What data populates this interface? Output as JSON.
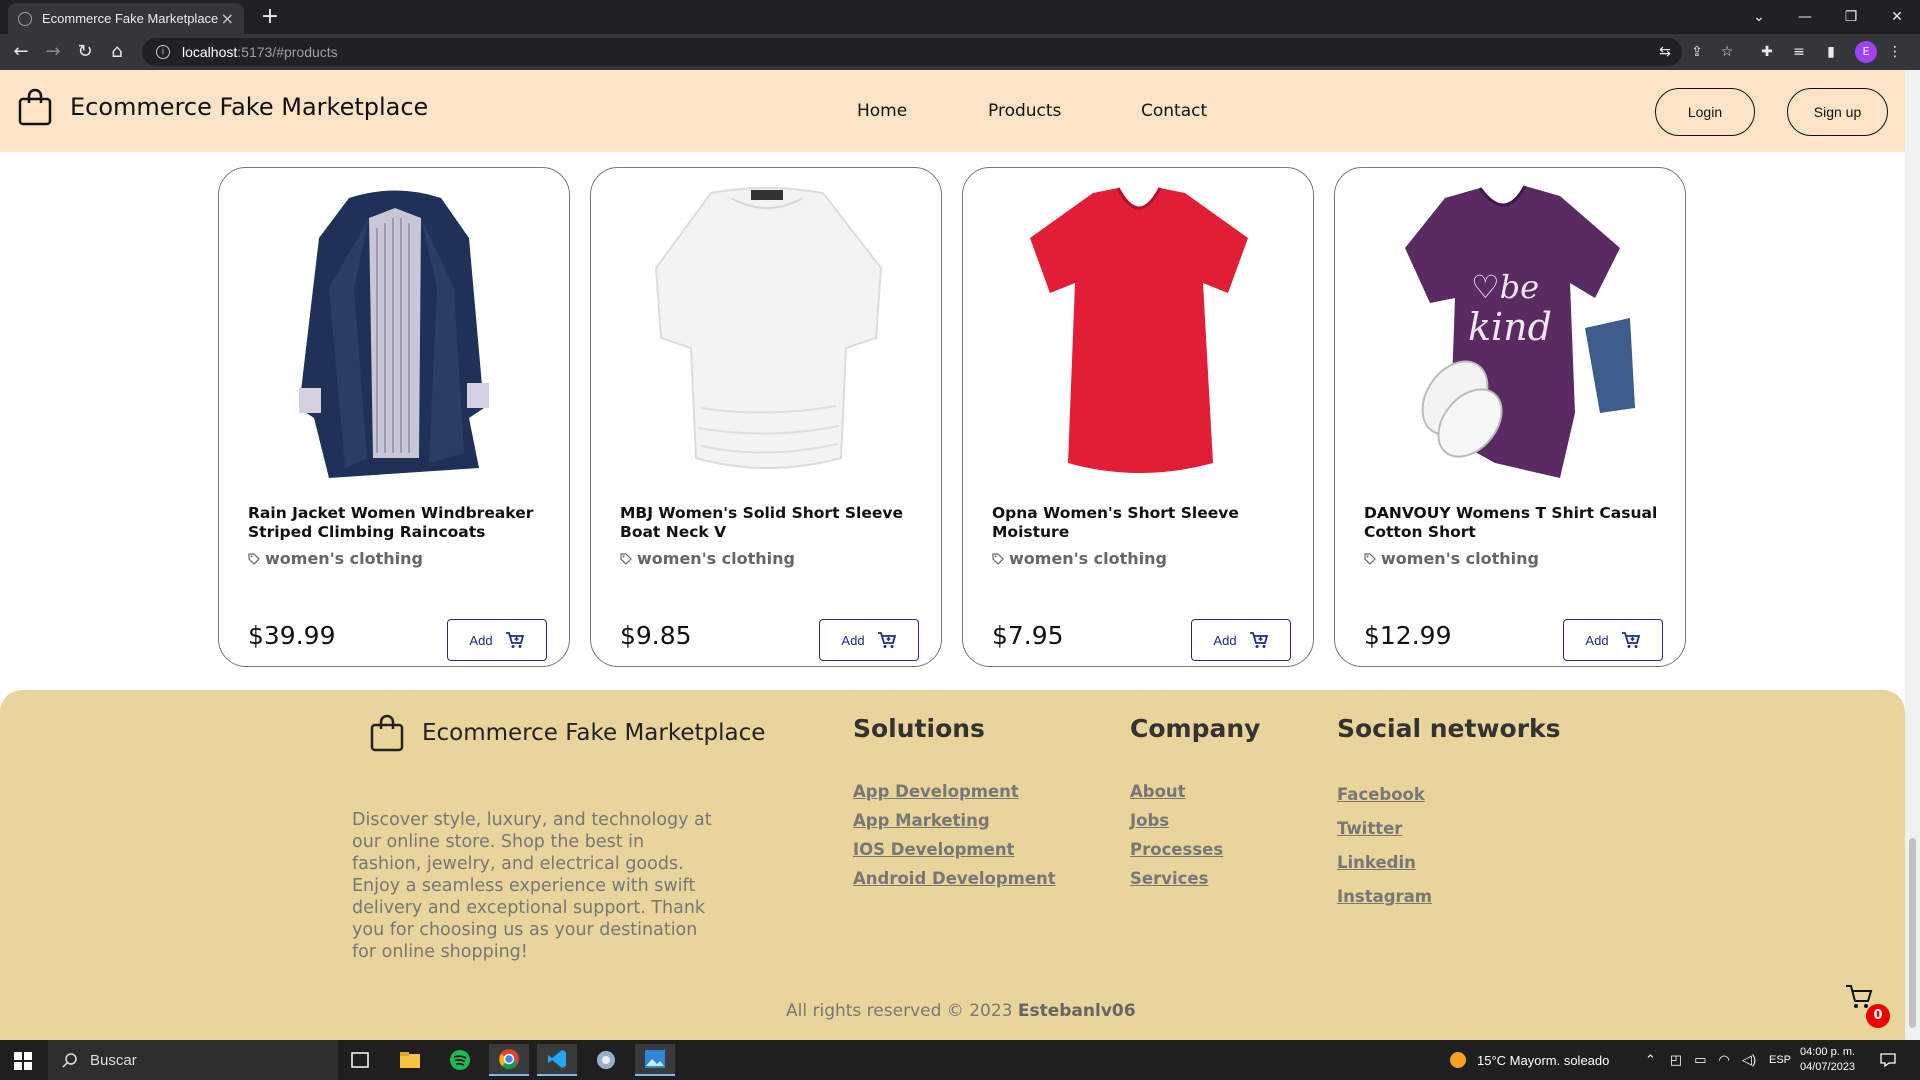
{
  "browser": {
    "tab_title": "Ecommerce Fake Marketplace",
    "url_host": "localhost",
    "url_path": ":5173/#products",
    "profile_initial": "E"
  },
  "header": {
    "brand": "Ecommerce Fake Marketplace",
    "nav": [
      "Home",
      "Products",
      "Contact"
    ],
    "login": "Login",
    "signup": "Sign up"
  },
  "products": [
    {
      "title": "Rain Jacket Women Windbreaker Striped Climbing Raincoats",
      "category": "women's clothing",
      "price": "$39.99",
      "add": "Add"
    },
    {
      "title": "MBJ Women's Solid Short Sleeve Boat Neck V",
      "category": "women's clothing",
      "price": "$9.85",
      "add": "Add"
    },
    {
      "title": "Opna Women's Short Sleeve Moisture",
      "category": "women's clothing",
      "price": "$7.95",
      "add": "Add"
    },
    {
      "title": "DANVOUY Womens T Shirt Casual Cotton Short",
      "category": "women's clothing",
      "price": "$12.99",
      "add": "Add"
    }
  ],
  "footer": {
    "brand": "Ecommerce Fake Marketplace",
    "description": "Discover style, luxury, and technology at our online store. Shop the best in fashion, jewelry, and electrical goods. Enjoy a seamless experience with swift delivery and exceptional support. Thank you for choosing us as your destination for online shopping!",
    "solutions": {
      "title": "Solutions",
      "links": [
        "App Development",
        "App Marketing",
        "IOS Development",
        "Android Development"
      ]
    },
    "company": {
      "title": "Company",
      "links": [
        "About",
        "Jobs",
        "Processes",
        "Services"
      ]
    },
    "social": {
      "title": "Social networks",
      "links": [
        "Facebook",
        "Twitter",
        "Linkedin",
        "Instagram"
      ]
    },
    "copyright_prefix": "All rights reserved © 2023",
    "copyright_author": "Estebanlv06",
    "cart_count": "0"
  },
  "taskbar": {
    "search_placeholder": "Buscar",
    "weather": "15°C  Mayorm. soleado",
    "lang": "ESP",
    "time": "04:00 p. m.",
    "date": "04/07/2023"
  },
  "colors": {
    "header_bg": "#fde4c6",
    "footer_bg": "#e9d49b",
    "add_button": "#1e2a8a",
    "cart_badge": "#ee0000"
  }
}
